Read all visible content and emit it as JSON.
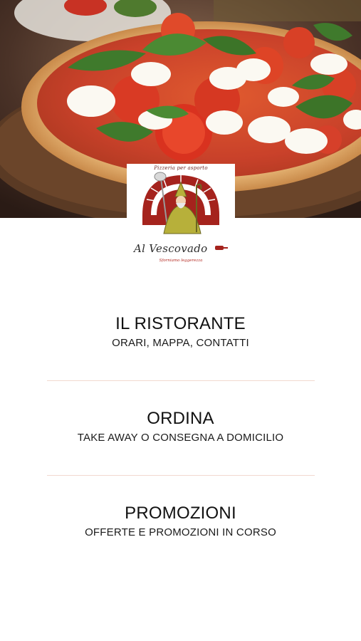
{
  "hero": {
    "image": "pizza-margherita-photo"
  },
  "logo": {
    "caption": "Pizzeria per asporto",
    "brand_name": "Al Vescovado",
    "tagline": "Sforniamo leggerezza",
    "icon": "bishop-pizza-oven-logo"
  },
  "menu": {
    "items": [
      {
        "title": "IL RISTORANTE",
        "subtitle": "ORARI, MAPPA, CONTATTI"
      },
      {
        "title": "ORDINA",
        "subtitle": "TAKE AWAY O CONSEGNA A DOMICILIO"
      },
      {
        "title": "PROMOZIONI",
        "subtitle": "OFFERTE E PROMOZIONI IN CORSO"
      }
    ]
  },
  "colors": {
    "brand_red": "#a5231d",
    "divider": "#f2d9cf",
    "text": "#111111",
    "background": "#ffffff"
  }
}
